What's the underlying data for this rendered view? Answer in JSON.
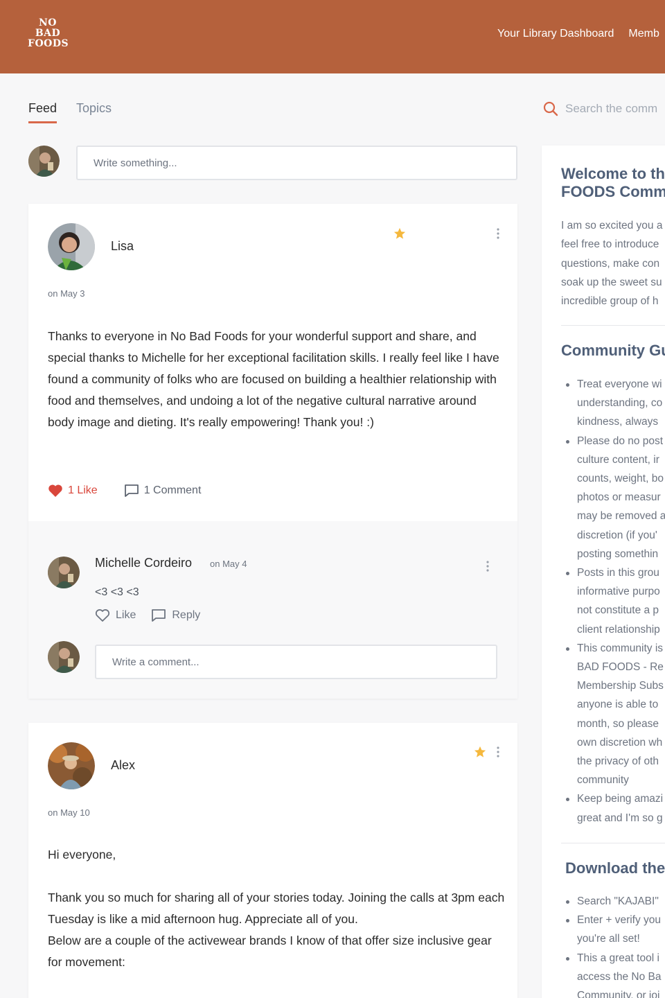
{
  "brand": {
    "logo_lines": [
      "NO",
      "BAD",
      "FOODS"
    ],
    "color": "#b5613c"
  },
  "nav": {
    "items": [
      "Your Library Dashboard",
      "Memb"
    ]
  },
  "tabs": [
    {
      "label": "Feed",
      "active": true
    },
    {
      "label": "Topics",
      "active": false
    }
  ],
  "search": {
    "placeholder": "Search the comm",
    "icon": "search-icon"
  },
  "composer": {
    "placeholder": "Write something..."
  },
  "posts": [
    {
      "author": "Lisa",
      "date": "on May 3",
      "starred": true,
      "body": "Thanks to everyone in No Bad Foods for your wonderful support and share, and special thanks to Michelle for her exceptional facilitation skills. I really feel like I have found a community of folks who are focused on building a healthier relationship with food and themselves, and undoing a lot of the negative cultural narrative around body image and dieting. It's really empowering! Thank you! :)",
      "like_label": "1 Like",
      "comment_label": "1 Comment",
      "comments": [
        {
          "author": "Michelle Cordeiro",
          "date": "on May 4",
          "text": "<3 <3 <3",
          "like_label": "Like",
          "reply_label": "Reply"
        }
      ],
      "comment_placeholder": "Write a comment..."
    },
    {
      "author": "Alex",
      "date": "on May 10",
      "starred": true,
      "body_paragraphs": [
        "Hi everyone,",
        "Thank you so much for sharing all of your stories today. Joining the calls at 3pm each Tuesday is like a mid afternoon hug. Appreciate all of you.",
        "Below are a couple of the activewear brands I know of that offer size inclusive gear for movement:"
      ]
    }
  ],
  "sidebar": {
    "welcome_title_lines": [
      "Welcome to th",
      "FOODS Comm"
    ],
    "intro_lines": [
      "I am so excited you a",
      "feel free to introduce",
      "questions, make con",
      "soak up the sweet su",
      "incredible group of h"
    ],
    "guidelines_heading": "Community Gu",
    "guidelines": [
      [
        "Treat everyone wi",
        "understanding, co",
        "kindness, always"
      ],
      [
        "Please do no post",
        "culture content, ir",
        "counts, weight, bo",
        "photos or measur",
        "may be removed a",
        "discretion (if you'",
        "posting somethin"
      ],
      [
        "Posts in this grou",
        "informative purpo",
        "not constitute a p",
        "client relationship"
      ],
      [
        "This community is",
        "BAD FOODS - Re",
        "Membership Subs",
        "anyone is able to",
        "month, so please",
        "own discretion wh",
        "the privacy of oth",
        "community"
      ],
      [
        "Keep being amazi",
        "great and I'm so g"
      ]
    ],
    "download_heading": "Download the",
    "download_items": [
      [
        "Search \"KAJABI\""
      ],
      [
        "Enter + verify you",
        "you're all set!"
      ],
      [
        "This a great tool i",
        "access the No Ba",
        "Community, or joi"
      ]
    ]
  },
  "colors": {
    "accent": "#d9684a",
    "like": "#d9463b",
    "star": "#f5b83d",
    "heading": "#4f5f78"
  }
}
